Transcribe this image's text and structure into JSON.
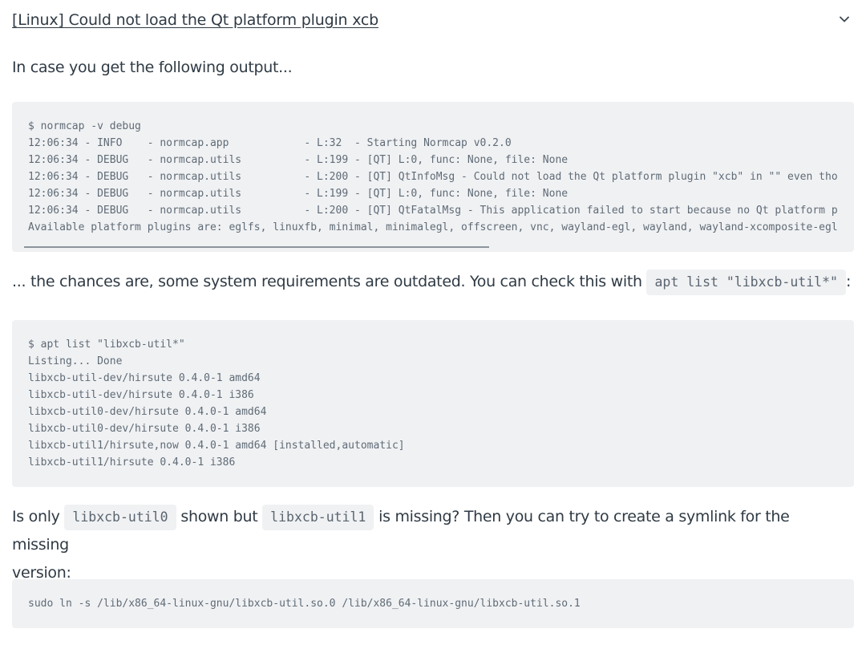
{
  "section": {
    "title": "[Linux] Could not load the Qt platform plugin xcb",
    "icon": "chevron-down-icon"
  },
  "para1": "In case you get the following output...",
  "code1": [
    "$ normcap -v debug",
    "12:06:34 - INFO    - normcap.app            - L:32  - Starting Normcap v0.2.0",
    "12:06:34 - DEBUG   - normcap.utils          - L:199 - [QT] L:0, func: None, file: None",
    "12:06:34 - DEBUG   - normcap.utils          - L:200 - [QT] QtInfoMsg - Could not load the Qt platform plugin \"xcb\" in \"\" even tho",
    "12:06:34 - DEBUG   - normcap.utils          - L:199 - [QT] L:0, func: None, file: None",
    "12:06:34 - DEBUG   - normcap.utils          - L:200 - [QT] QtFatalMsg - This application failed to start because no Qt platform p",
    "Available platform plugins are: eglfs, linuxfb, minimal, minimalegl, offscreen, vnc, wayland-egl, wayland, wayland-xcomposite-egl"
  ],
  "para2": {
    "before": "... the chances are, some system requirements are outdated. You can check this with",
    "code": "apt list \"libxcb-util*\"",
    "after": ":"
  },
  "code2": [
    "$ apt list \"libxcb-util*\"",
    "Listing... Done",
    "libxcb-util-dev/hirsute 0.4.0-1 amd64",
    "libxcb-util-dev/hirsute 0.4.0-1 i386",
    "libxcb-util0-dev/hirsute 0.4.0-1 amd64",
    "libxcb-util0-dev/hirsute 0.4.0-1 i386",
    "libxcb-util1/hirsute,now 0.4.0-1 amd64 [installed,automatic]",
    "libxcb-util1/hirsute 0.4.0-1 i386"
  ],
  "para3": {
    "t1": "Is only",
    "c1": "libxcb-util0",
    "t2": "shown but",
    "c2": "libxcb-util1",
    "t3": "is missing? Then you can try to create a symlink for the missing",
    "t4": "version:"
  },
  "code3": [
    "sudo ln -s /lib/x86_64-linux-gnu/libxcb-util.so.0 /lib/x86_64-linux-gnu/libxcb-util.so.1"
  ]
}
